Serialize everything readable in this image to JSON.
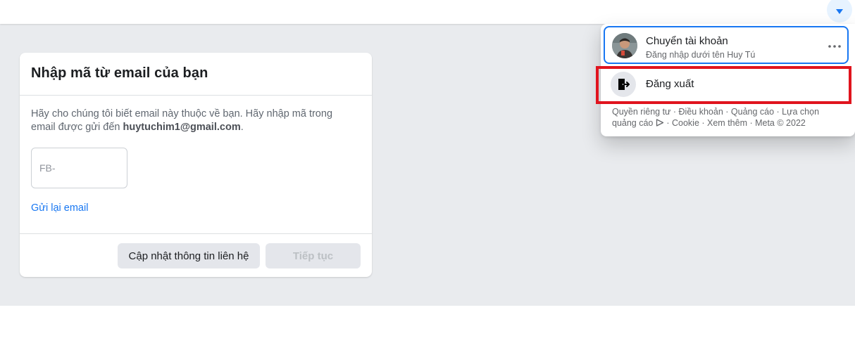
{
  "card": {
    "title": "Nhập mã từ email của bạn",
    "description": "Hãy cho chúng tôi biết email này thuộc về bạn. Hãy nhập mã trong email được gửi đến ",
    "email": "huytuchim1@gmail.com",
    "description_end": ".",
    "code_placeholder": "FB-",
    "resend_label": "Gửi lại email",
    "update_button": "Cập nhật thông tin liên hệ",
    "continue_button": "Tiếp tục"
  },
  "menu": {
    "switch_title": "Chuyển tài khoản",
    "switch_subtitle": "Đăng nhập dưới tên Huy Tú",
    "logout_label": "Đăng xuất",
    "footer": {
      "privacy": "Quyền riêng tư",
      "terms": "Điều khoản",
      "ads": "Quảng cáo",
      "ad_choices": "Lựa chọn quảng cáo",
      "cookie": "Cookie",
      "more": "Xem thêm",
      "meta": "Meta © 2022",
      "separator": " · "
    }
  },
  "colors": {
    "accent": "#1877f2",
    "highlight": "#e0141e",
    "background": "#e9ebee"
  },
  "icons": {
    "account": "caret-down-icon",
    "more": "more-dots-icon",
    "logout": "logout-door-icon",
    "ad_choices": "ad-choices-icon"
  }
}
